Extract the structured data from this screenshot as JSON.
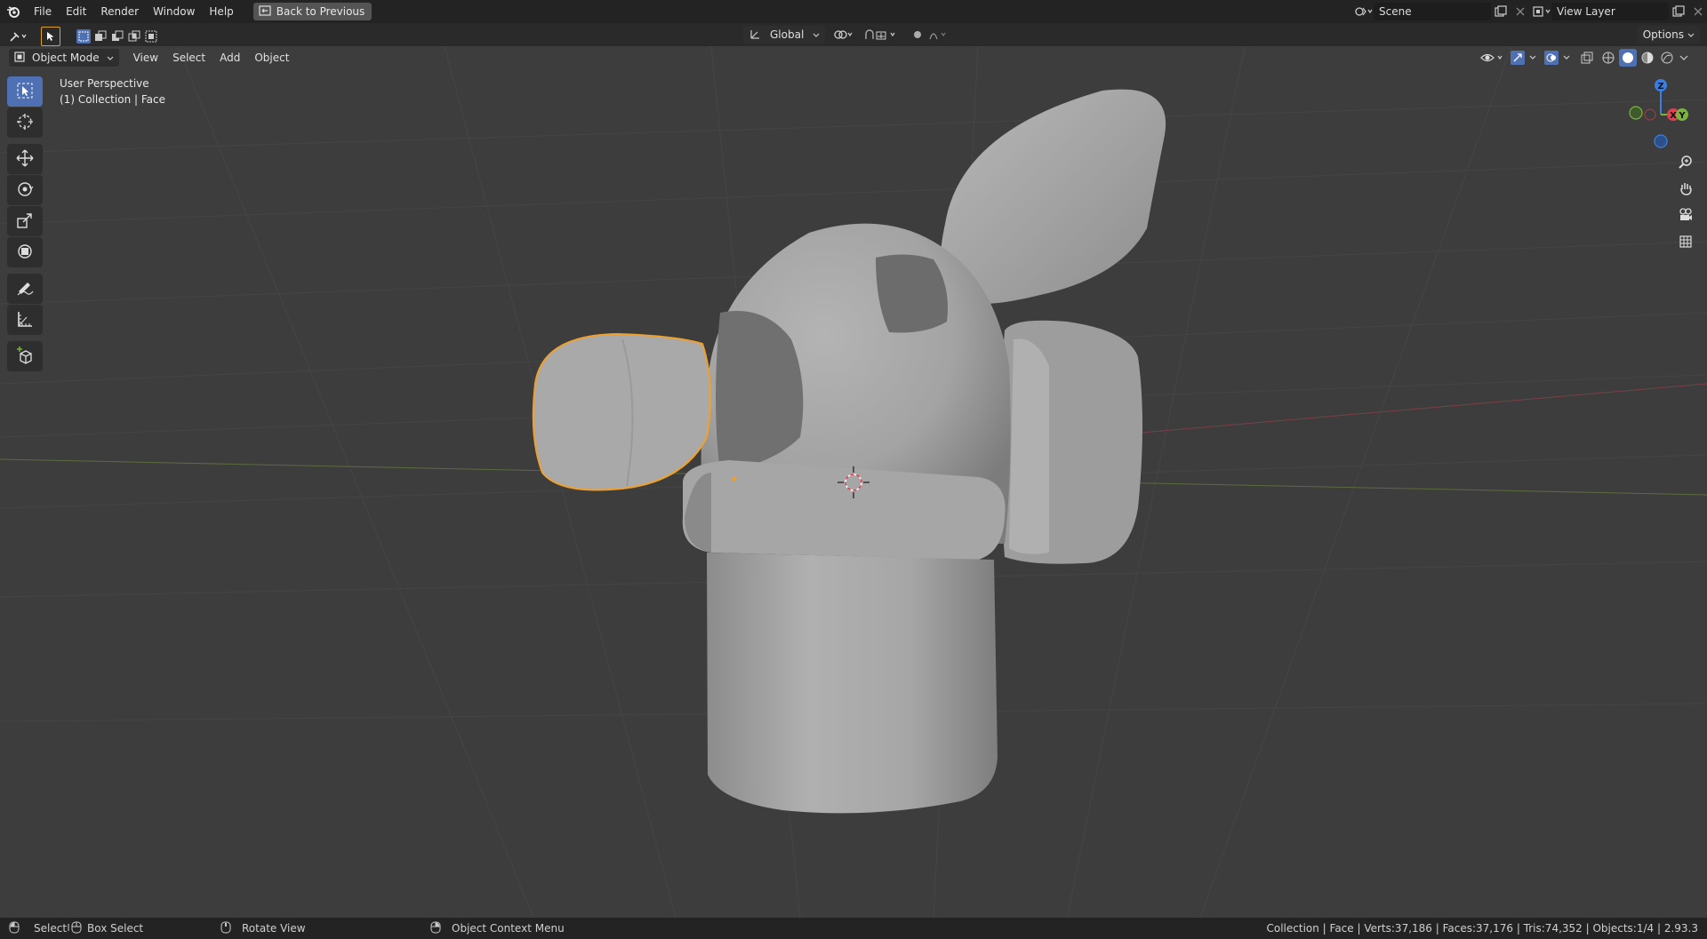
{
  "menubar": {
    "items": [
      "File",
      "Edit",
      "Render",
      "Window",
      "Help"
    ],
    "back_button": "Back to Previous",
    "scene": "Scene",
    "view_layer": "View Layer"
  },
  "tool_header": {
    "transform_orientation": "Global",
    "options_label": "Options"
  },
  "viewport_header": {
    "mode": "Object Mode",
    "menus": [
      "View",
      "Select",
      "Add",
      "Object"
    ]
  },
  "viewport": {
    "perspective_label": "User Perspective",
    "collection_label": "(1) Collection | Face",
    "gizmo": {
      "z": "Z",
      "y": "Y",
      "x": "X"
    }
  },
  "toolbar": {
    "tools": [
      "select-box-icon",
      "cursor-icon",
      "move-icon",
      "rotate-icon",
      "scale-icon",
      "transform-icon",
      "annotate-icon",
      "measure-icon",
      "add-cube-icon"
    ]
  },
  "statusbar": {
    "select": "Select",
    "box_select": "Box Select",
    "rotate_view": "Rotate View",
    "context_menu": "Object Context Menu",
    "stats": "Collection | Face | Verts:37,186 | Faces:37,176 | Tris:74,352 | Objects:1/4 | 2.93.3"
  },
  "colors": {
    "accent": "#4f71b3",
    "selection_outline": "#f0a02c",
    "axis_x": "#e04050",
    "axis_y": "#7ab43c",
    "axis_z": "#3c7ee0",
    "background": "#3d3d3d"
  }
}
